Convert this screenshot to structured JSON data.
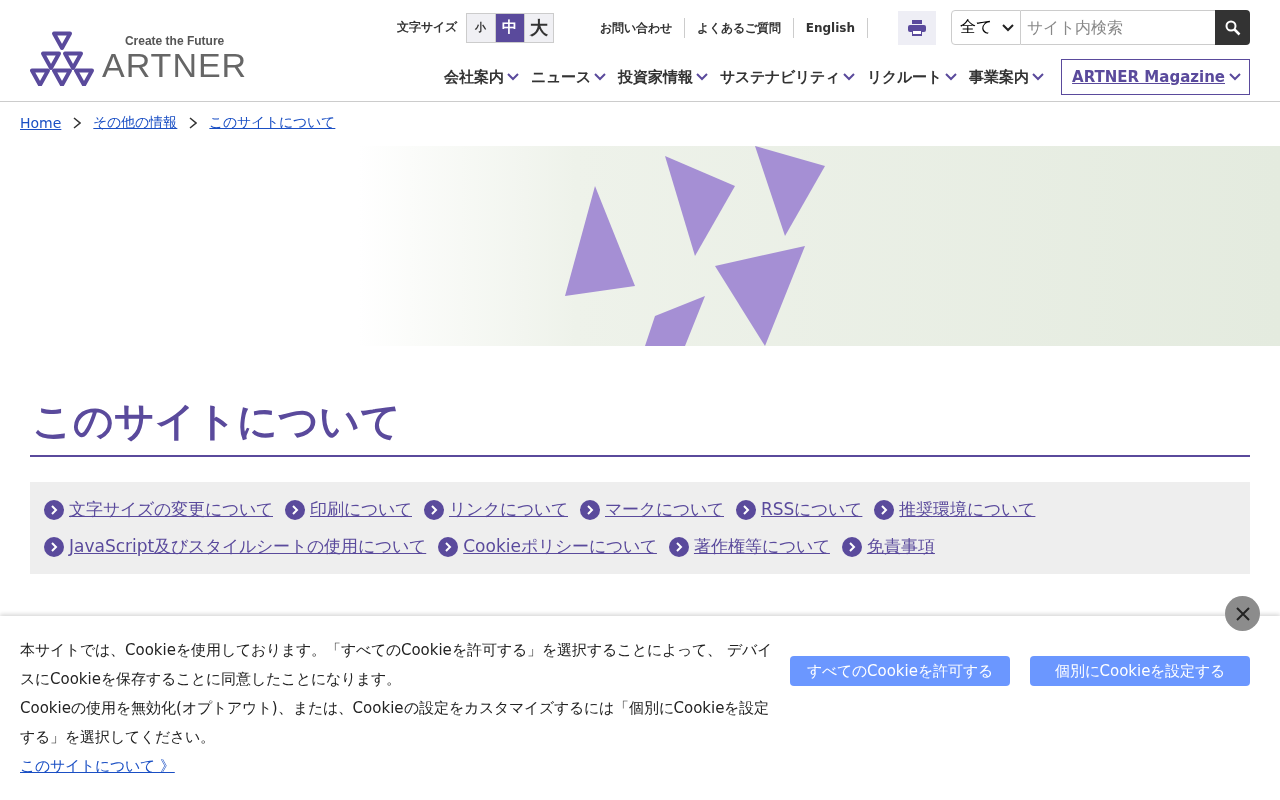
{
  "header": {
    "logo": {
      "tagline": "Create the Future",
      "name": "ARTNER"
    },
    "font_size": {
      "label": "文字サイズ",
      "options": [
        {
          "label": "小",
          "selected": false
        },
        {
          "label": "中",
          "selected": true
        },
        {
          "label": "大",
          "selected": false
        }
      ]
    },
    "utility_links": [
      "お問い合わせ",
      "よくあるご質問",
      "English"
    ],
    "search": {
      "scope": "全て",
      "placeholder": "サイト内検索"
    },
    "nav": [
      "会社案内",
      "ニュース",
      "投資家情報",
      "サステナビリティ",
      "リクルート",
      "事業案内"
    ],
    "magazine": "ARTNER Magazine"
  },
  "breadcrumb": [
    "Home",
    "その他の情報",
    "このサイトについて"
  ],
  "page_title": "このサイトについて",
  "anchor_links": [
    "文字サイズの変更について",
    "印刷について",
    "リンクについて",
    "マークについて",
    "RSSについて",
    "推奨環境について",
    "JavaScript及びスタイルシートの使用について",
    "Cookieポリシーについて",
    "著作権等について",
    "免責事項"
  ],
  "cookie_banner": {
    "paragraphs": [
      "本サイトでは、Cookieを使用しております。「すべてのCookieを許可する」を選択することによって、 デバイスにCookieを保存することに同意したことになります。",
      "Cookieの使用を無効化(オプトアウト)、または、Cookieの設定をカスタマイズするには「個別にCookieを設定する」を選択してください。"
    ],
    "link": "このサイトについて 》",
    "buttons": [
      "すべてのCookieを許可する",
      "個別にCookieを設定する"
    ]
  }
}
